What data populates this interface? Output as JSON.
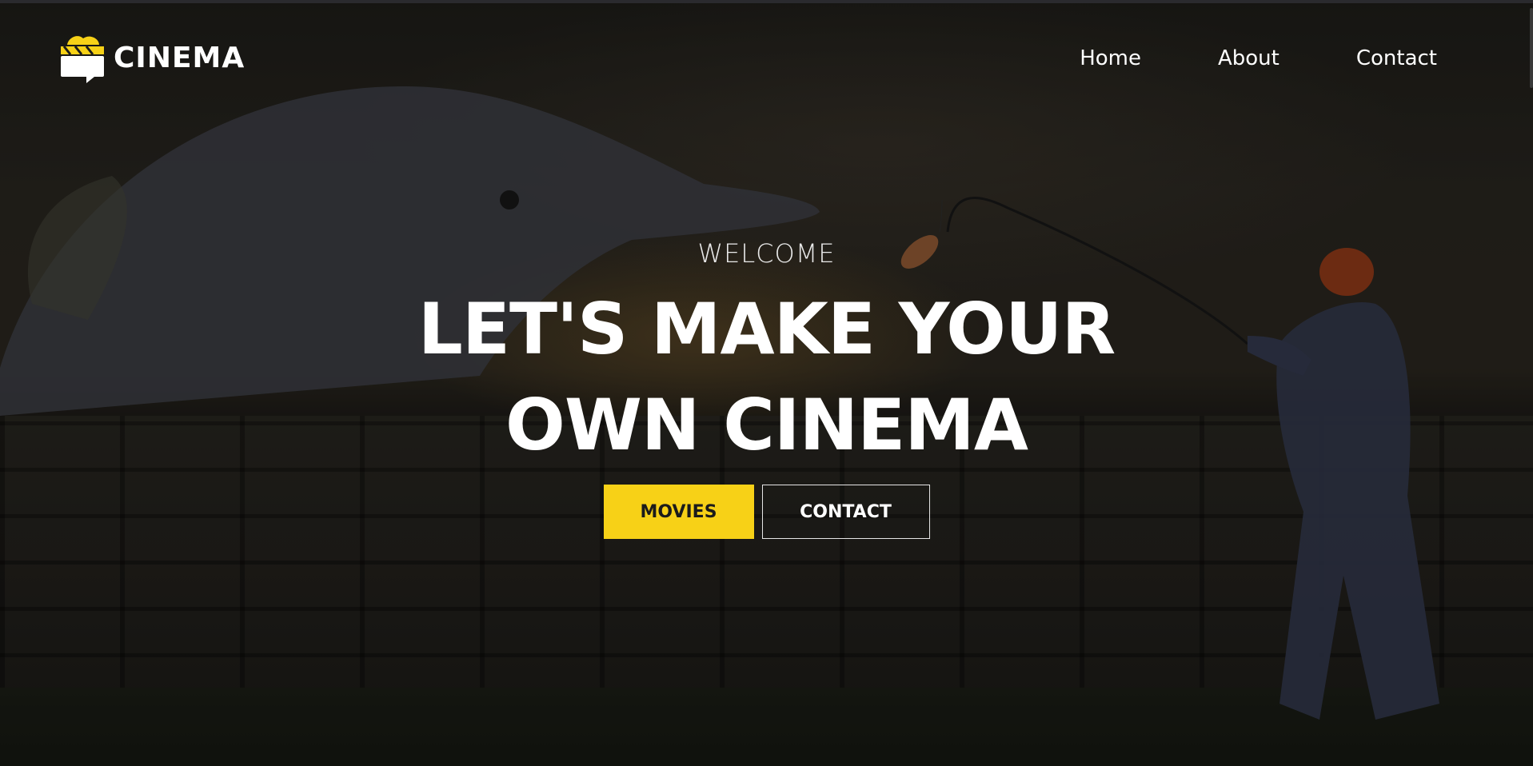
{
  "header": {
    "logo_text": "CINEMA",
    "logo_icon": "clapperboard-icon",
    "nav": [
      {
        "label": "Home"
      },
      {
        "label": "About"
      },
      {
        "label": "Contact"
      }
    ]
  },
  "hero": {
    "eyebrow": "WELCOME",
    "headline_line1": "LET'S MAKE YOUR",
    "headline_line2": "OWN CINEMA",
    "primary_button": "MOVIES",
    "secondary_button": "CONTACT"
  },
  "colors": {
    "accent": "#f7d117",
    "text": "#ffffff",
    "overlay": "#000000"
  }
}
